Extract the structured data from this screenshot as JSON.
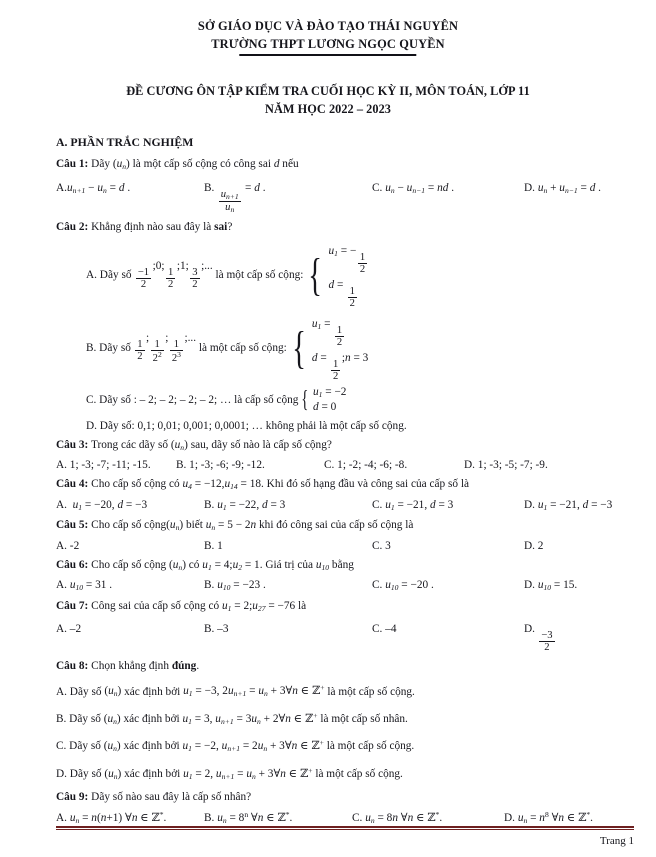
{
  "header": {
    "department": "SỞ GIÁO DỤC VÀ ĐÀO TẠO THÁI NGUYÊN",
    "school": "TRƯỜNG THPT LƯƠNG NGỌC QUYỀN",
    "title": "ĐỀ CƯƠNG ÔN TẬP KIỂM TRA CUỐI HỌC KỲ II, MÔN TOÁN, LỚP 11",
    "school_year": "NĂM HỌC 2022 – 2023"
  },
  "section": {
    "heading": "A. PHẦN TRẮC NGHIỆM"
  },
  "questions": {
    "q1": {
      "label": "Câu 1:",
      "text_a": "Dãy",
      "text_b": "là một cấp số cộng có công sai",
      "text_c": "nếu",
      "optA": "A.",
      "optB": "B.",
      "optC": "C.",
      "optD": "D."
    },
    "q2": {
      "label": "Câu 2:",
      "text": "Khẳng định nào sau đây là",
      "bold_word": "sai",
      "qmark": "?",
      "a_prefix": "A. Dãy số",
      "a_mid": "là một cấp số cộng:",
      "b_prefix": "B. Dãy số",
      "b_mid": "là một cấp số cộng:",
      "c_prefix": "C. Dãy số : – 2; – 2; – 2; – 2; …  là cấp số cộng",
      "d_text": "D. Dãy số: 0,1; 0,01; 0,001; 0,0001; … không phải là một cấp số cộng."
    },
    "q3": {
      "label": "Câu 3:",
      "text_a": "Trong các dãy số",
      "text_b": "sau, dãy số nào là cấp số cộng?",
      "optA": "A. 1; -3; -7; -11; -15.",
      "optB": "B. 1; -3; -6; -9; -12.",
      "optC": "C. 1; -2; -4; -6; -8.",
      "optD": "D. 1; -3; -5; -7; -9."
    },
    "q4": {
      "label": "Câu 4:",
      "text_a": "Cho cấp số cộng có",
      "text_b": ". Khi đó số hạng đầu và công sai của cấp số là",
      "optA": "A.",
      "optB": "B.",
      "optC": "C.",
      "optD": "D."
    },
    "q5": {
      "label": "Câu 5:",
      "text_a": "Cho cấp số cộng",
      "text_b": "biết",
      "text_c": "khi đó công sai của cấp số cộng là",
      "optA": "A. -2",
      "optB": "B. 1",
      "optC": "C. 3",
      "optD": "D. 2"
    },
    "q6": {
      "label": "Câu 6:",
      "text_a": "Cho cấp số cộng",
      "text_b": "có",
      "text_c": ". Giá trị của",
      "text_d": "bằng",
      "optA": "A.",
      "optB": "B.",
      "optC": "C.",
      "optD": "D."
    },
    "q7": {
      "label": "Câu 7:",
      "text_a": "Công sai của cấp số cộng có",
      "text_b": "là",
      "optA": "A. –2",
      "optB": "B. –3",
      "optC": "C. –4",
      "optD": "D."
    },
    "q8": {
      "label": "Câu 8:",
      "text": "Chọn khẳng định",
      "bold_word": "đúng",
      "period": ".",
      "a_prefix": "A. Dãy số",
      "a_mid": "xác định bởi",
      "a_suffix": "là một cấp số cộng.",
      "b_prefix": "B. Dãy số",
      "b_mid": "xác định bởi",
      "b_suffix": "là một cấp số nhân.",
      "c_prefix": "C. Dãy số",
      "c_mid": "xác định bởi",
      "c_suffix": "là một cấp số cộng.",
      "d_prefix": "D. Dãy số",
      "d_mid": "xác định bởi",
      "d_suffix": "là một cấp số cộng."
    },
    "q9": {
      "label": "Câu 9:",
      "text": "Dãy số nào sau đây là cấp số nhân?",
      "optA": "A.",
      "optB": "B.",
      "optC": "C.",
      "optD": "D."
    }
  },
  "footer": {
    "page_label": "Trang 1",
    "rule_color": "#6e2020"
  }
}
